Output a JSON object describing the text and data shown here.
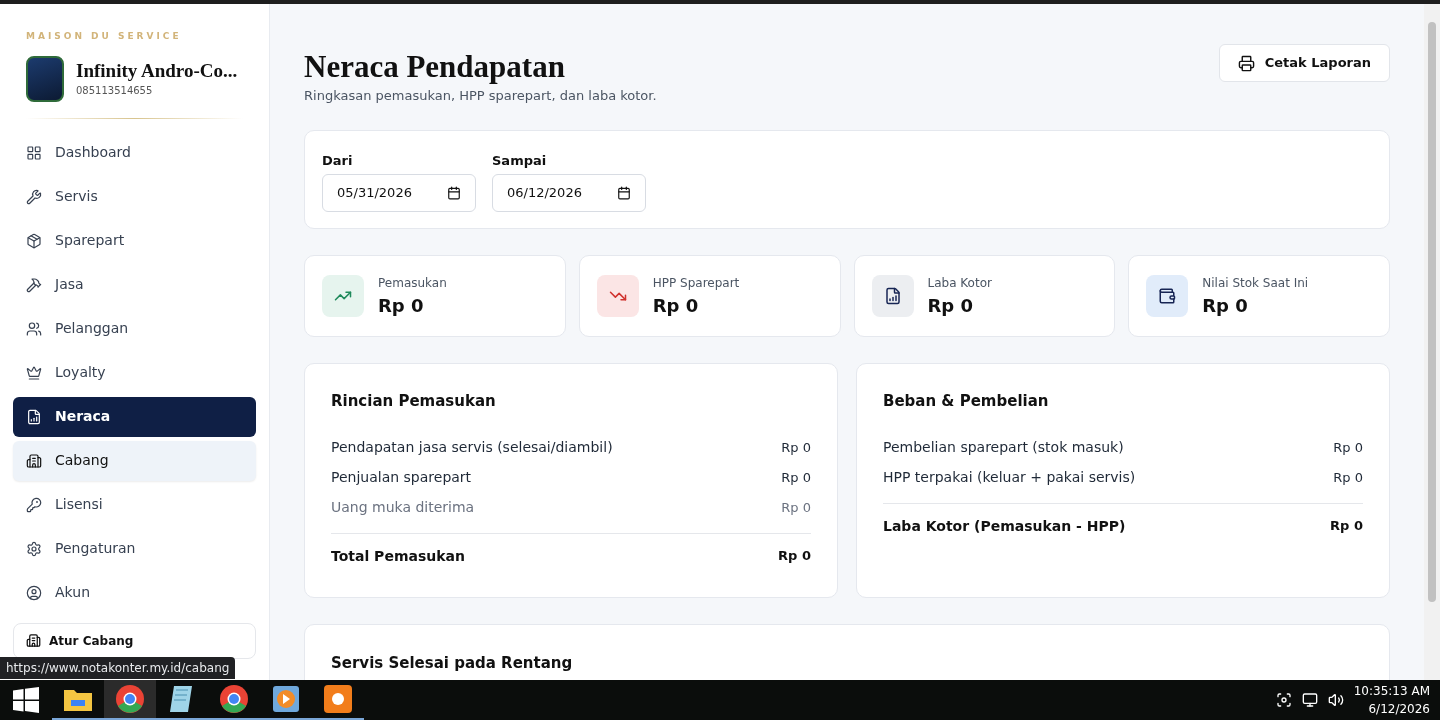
{
  "sidebar": {
    "tagline": "MAISON DU SERVICE",
    "brand": "Infinity Andro-Co...",
    "phone": "085113514655",
    "items": [
      {
        "label": "Dashboard",
        "selected": false,
        "hovered": false
      },
      {
        "label": "Servis",
        "selected": false,
        "hovered": false
      },
      {
        "label": "Sparepart",
        "selected": false,
        "hovered": false
      },
      {
        "label": "Jasa",
        "selected": false,
        "hovered": false
      },
      {
        "label": "Pelanggan",
        "selected": false,
        "hovered": false
      },
      {
        "label": "Loyalty",
        "selected": false,
        "hovered": false
      },
      {
        "label": "Neraca",
        "selected": true,
        "hovered": false
      },
      {
        "label": "Cabang",
        "selected": false,
        "hovered": true
      },
      {
        "label": "Lisensi",
        "selected": false,
        "hovered": false
      },
      {
        "label": "Pengaturan",
        "selected": false,
        "hovered": false
      },
      {
        "label": "Akun",
        "selected": false,
        "hovered": false
      }
    ],
    "branch_button": "Atur Cabang"
  },
  "header": {
    "title": "Neraca Pendapatan",
    "subtitle": "Ringkasan pemasukan, HPP sparepart, dan laba kotor.",
    "print_button": "Cetak Laporan"
  },
  "filter": {
    "from": {
      "label": "Dari",
      "value": "05/31/2026"
    },
    "to": {
      "label": "Sampai",
      "value": "06/12/2026"
    }
  },
  "stats": [
    {
      "kind": "up",
      "label": "Pemasukan",
      "value": "Rp 0"
    },
    {
      "kind": "down",
      "label": "HPP Sparepart",
      "value": "Rp 0"
    },
    {
      "kind": "report",
      "label": "Laba Kotor",
      "value": "Rp 0"
    },
    {
      "kind": "wallet",
      "label": "Nilai Stok Saat Ini",
      "value": "Rp 0"
    }
  ],
  "panels": [
    {
      "title": "Rincian Pemasukan",
      "rows": [
        {
          "kind": "line",
          "muted": false,
          "label": "Pendapatan jasa servis (selesai/diambil)",
          "value": "Rp 0"
        },
        {
          "kind": "line",
          "muted": false,
          "label": "Penjualan sparepart",
          "value": "Rp 0"
        },
        {
          "kind": "line",
          "muted": true,
          "label": "Uang muka diterima",
          "value": "Rp 0"
        },
        {
          "kind": "total",
          "muted": false,
          "label": "Total Pemasukan",
          "value": "Rp 0"
        }
      ]
    },
    {
      "title": "Beban & Pembelian",
      "rows": [
        {
          "kind": "line",
          "muted": false,
          "label": "Pembelian sparepart (stok masuk)",
          "value": "Rp 0"
        },
        {
          "kind": "line",
          "muted": false,
          "label": "HPP terpakai (keluar + pakai servis)",
          "value": "Rp 0"
        },
        {
          "kind": "total",
          "muted": false,
          "label": "Laba Kotor (Pemasukan - HPP)",
          "value": "Rp 0"
        }
      ]
    }
  ],
  "bottom_panel": {
    "title": "Servis Selesai pada Rentang"
  },
  "status_url": "https://www.notakonter.my.id/cabang",
  "taskbar": {
    "apps": [
      {
        "kind": "folder",
        "selected": false
      },
      {
        "kind": "chrome",
        "selected": true
      },
      {
        "kind": "notepad",
        "selected": false
      },
      {
        "kind": "chrome",
        "selected": false
      },
      {
        "kind": "player",
        "selected": false
      },
      {
        "kind": "capture",
        "selected": false
      }
    ],
    "time": "10:35:13 AM",
    "date": "6/12/2026"
  }
}
